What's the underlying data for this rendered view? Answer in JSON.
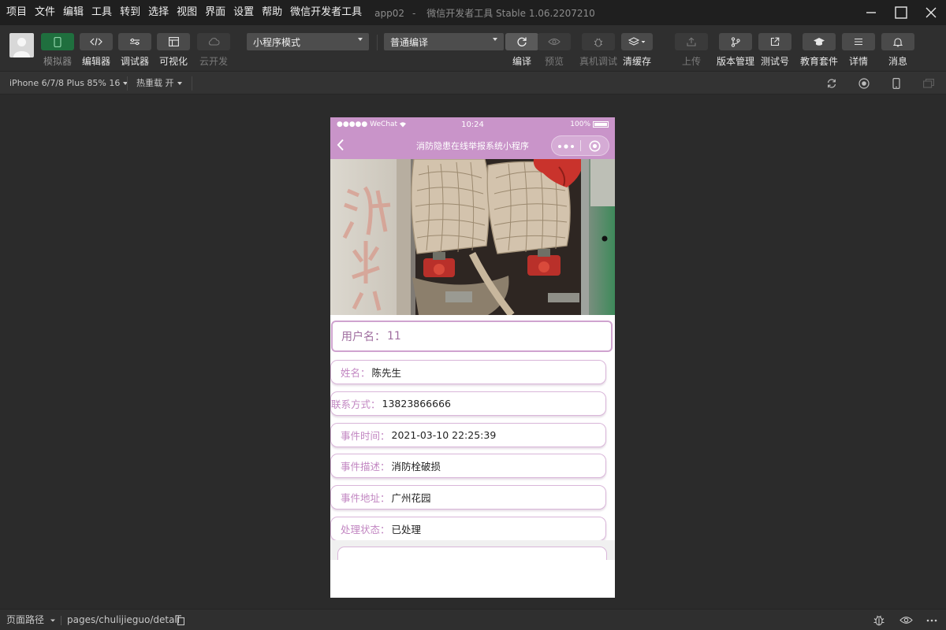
{
  "menubar": {
    "items": [
      "项目",
      "文件",
      "编辑",
      "工具",
      "转到",
      "选择",
      "视图",
      "界面",
      "设置",
      "帮助",
      "微信开发者工具"
    ],
    "project_name": "app02",
    "separator": "-",
    "tool_title": "微信开发者工具 Stable 1.06.2207210"
  },
  "toolbar": {
    "simulator": "模拟器",
    "editor": "编辑器",
    "debugger": "调试器",
    "visualize": "可视化",
    "cloud": "云开发",
    "mode_select": "小程序模式",
    "compile_select": "普通编译",
    "compile": "编译",
    "preview": "预览",
    "real_debug": "真机调试",
    "clear_cache": "清缓存",
    "upload": "上传",
    "version": "版本管理",
    "test_account": "测试号",
    "education": "教育套件",
    "details": "详情",
    "messages": "消息"
  },
  "subbar": {
    "device": "iPhone 6/7/8 Plus 85% 16",
    "hot_reload": "热重载 开"
  },
  "phone": {
    "status": {
      "carrier": "●●●●● WeChat",
      "time": "10:24",
      "battery": "100%"
    },
    "nav_title": "消防隐患在线举报系统小程序",
    "user": {
      "label": "用户名：",
      "value": "11"
    },
    "fields": [
      {
        "label": "姓名：",
        "value": "陈先生"
      },
      {
        "label": "联系方式：",
        "value": "13823866666"
      },
      {
        "label": "事件时间：",
        "value": "2021-03-10 22:25:39"
      },
      {
        "label": "事件描述：",
        "value": "消防栓破损"
      },
      {
        "label": "事件地址：",
        "value": "广州花园"
      },
      {
        "label": "处理状态：",
        "value": "已处理"
      }
    ]
  },
  "footer": {
    "page_path_label": "页面路径",
    "page_path": "pages/chulijieguo/detail"
  },
  "colors": {
    "accent_purple": "#c994c9",
    "label_purple": "#c286c2",
    "simulator_green": "#1f6f3e"
  }
}
